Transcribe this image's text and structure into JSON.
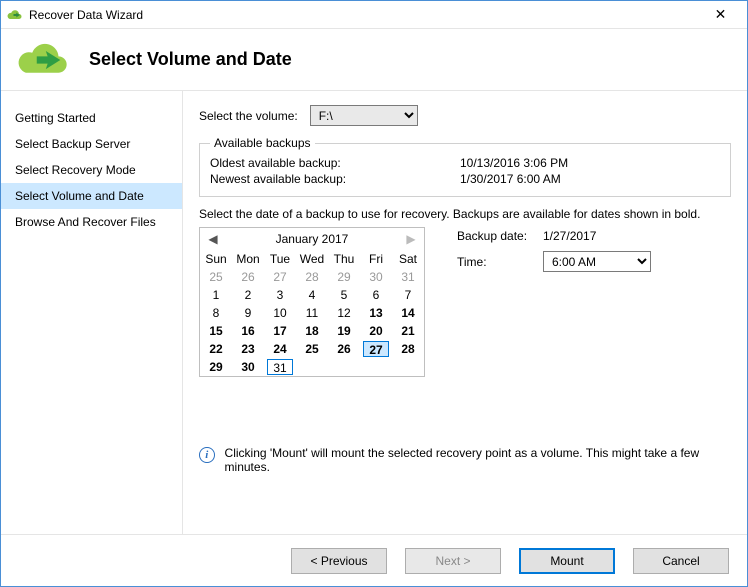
{
  "window": {
    "title": "Recover Data Wizard"
  },
  "header": {
    "title": "Select Volume and Date"
  },
  "sidebar": {
    "items": [
      {
        "label": "Getting Started"
      },
      {
        "label": "Select Backup Server"
      },
      {
        "label": "Select Recovery Mode"
      },
      {
        "label": "Select Volume and Date"
      },
      {
        "label": "Browse And Recover Files"
      }
    ],
    "selected_index": 3
  },
  "main": {
    "volume_label": "Select the volume:",
    "volume_value": "F:\\",
    "available_legend": "Available backups",
    "oldest_label": "Oldest available backup:",
    "oldest_value": "10/13/2016 3:06 PM",
    "newest_label": "Newest available backup:",
    "newest_value": "1/30/2017 6:00 AM",
    "instruction": "Select the date of a backup to use for recovery. Backups are available for dates shown in bold.",
    "backup_date_label": "Backup date:",
    "backup_date_value": "1/27/2017",
    "time_label": "Time:",
    "time_value": "6:00 AM",
    "info_text": "Clicking 'Mount' will mount the selected recovery point as a volume. This might take a few minutes."
  },
  "calendar": {
    "month_label": "January 2017",
    "dow": [
      "Sun",
      "Mon",
      "Tue",
      "Wed",
      "Thu",
      "Fri",
      "Sat"
    ],
    "weeks": [
      [
        {
          "d": "25",
          "other": true
        },
        {
          "d": "26",
          "other": true
        },
        {
          "d": "27",
          "other": true
        },
        {
          "d": "28",
          "other": true
        },
        {
          "d": "29",
          "other": true
        },
        {
          "d": "30",
          "other": true
        },
        {
          "d": "31",
          "other": true
        }
      ],
      [
        {
          "d": "1"
        },
        {
          "d": "2"
        },
        {
          "d": "3"
        },
        {
          "d": "4"
        },
        {
          "d": "5"
        },
        {
          "d": "6"
        },
        {
          "d": "7"
        }
      ],
      [
        {
          "d": "8"
        },
        {
          "d": "9"
        },
        {
          "d": "10"
        },
        {
          "d": "11"
        },
        {
          "d": "12"
        },
        {
          "d": "13",
          "bold": true
        },
        {
          "d": "14",
          "bold": true
        }
      ],
      [
        {
          "d": "15",
          "bold": true
        },
        {
          "d": "16",
          "bold": true
        },
        {
          "d": "17",
          "bold": true
        },
        {
          "d": "18",
          "bold": true
        },
        {
          "d": "19",
          "bold": true
        },
        {
          "d": "20",
          "bold": true
        },
        {
          "d": "21",
          "bold": true
        }
      ],
      [
        {
          "d": "22",
          "bold": true
        },
        {
          "d": "23",
          "bold": true
        },
        {
          "d": "24",
          "bold": true
        },
        {
          "d": "25",
          "bold": true
        },
        {
          "d": "26",
          "bold": true
        },
        {
          "d": "27",
          "bold": true,
          "selected": true
        },
        {
          "d": "28",
          "bold": true
        }
      ],
      [
        {
          "d": "29",
          "bold": true
        },
        {
          "d": "30",
          "bold": true
        },
        {
          "d": "31",
          "today": true
        },
        {
          "d": ""
        },
        {
          "d": ""
        },
        {
          "d": ""
        },
        {
          "d": ""
        }
      ]
    ]
  },
  "footer": {
    "previous": "< Previous",
    "next": "Next >",
    "mount": "Mount",
    "cancel": "Cancel"
  }
}
